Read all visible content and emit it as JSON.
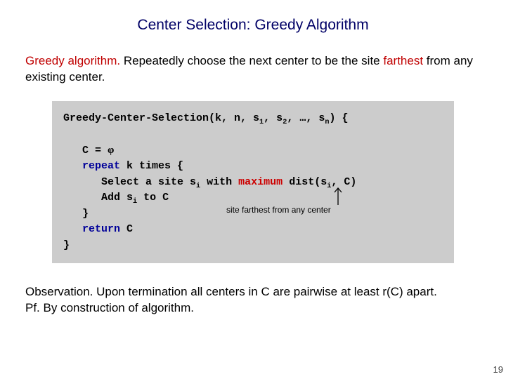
{
  "title": "Center Selection:  Greedy Algorithm",
  "intro": {
    "lead": "Greedy algorithm.  ",
    "rest_a": "Repeatedly choose the next center to be the site ",
    "farthest": "farthest",
    "rest_b": " from any existing center."
  },
  "code": {
    "l1_a": "Greedy-Center-Selection(k, n, s",
    "l1_b": ", s",
    "l1_c": ", …, s",
    "l1_d": ") {",
    "l3_a": "   C = ",
    "l3_phi": "φ",
    "l4_a": "   ",
    "l4_kw": "repeat",
    "l4_b": " k times {",
    "l5_a": "      Select a site s",
    "l5_b": " with ",
    "l5_flt": "maximum",
    "l5_c": " dist(s",
    "l5_d": ", C)",
    "l6_a": "      Add s",
    "l6_b": " to C",
    "l7_a": "   }",
    "l8_a": "   ",
    "l8_kw": "return",
    "l8_b": " C",
    "l9_a": "}",
    "sub1": "1",
    "sub2": "2",
    "subn": "n",
    "subi": "i"
  },
  "annot": "site farthest from any center",
  "obs": {
    "lead": "Observation. ",
    "rest": "Upon termination all centers in C are pairwise at least r(C) apart.",
    "pf": "Pf.  By construction of algorithm. "
  },
  "page": "19"
}
